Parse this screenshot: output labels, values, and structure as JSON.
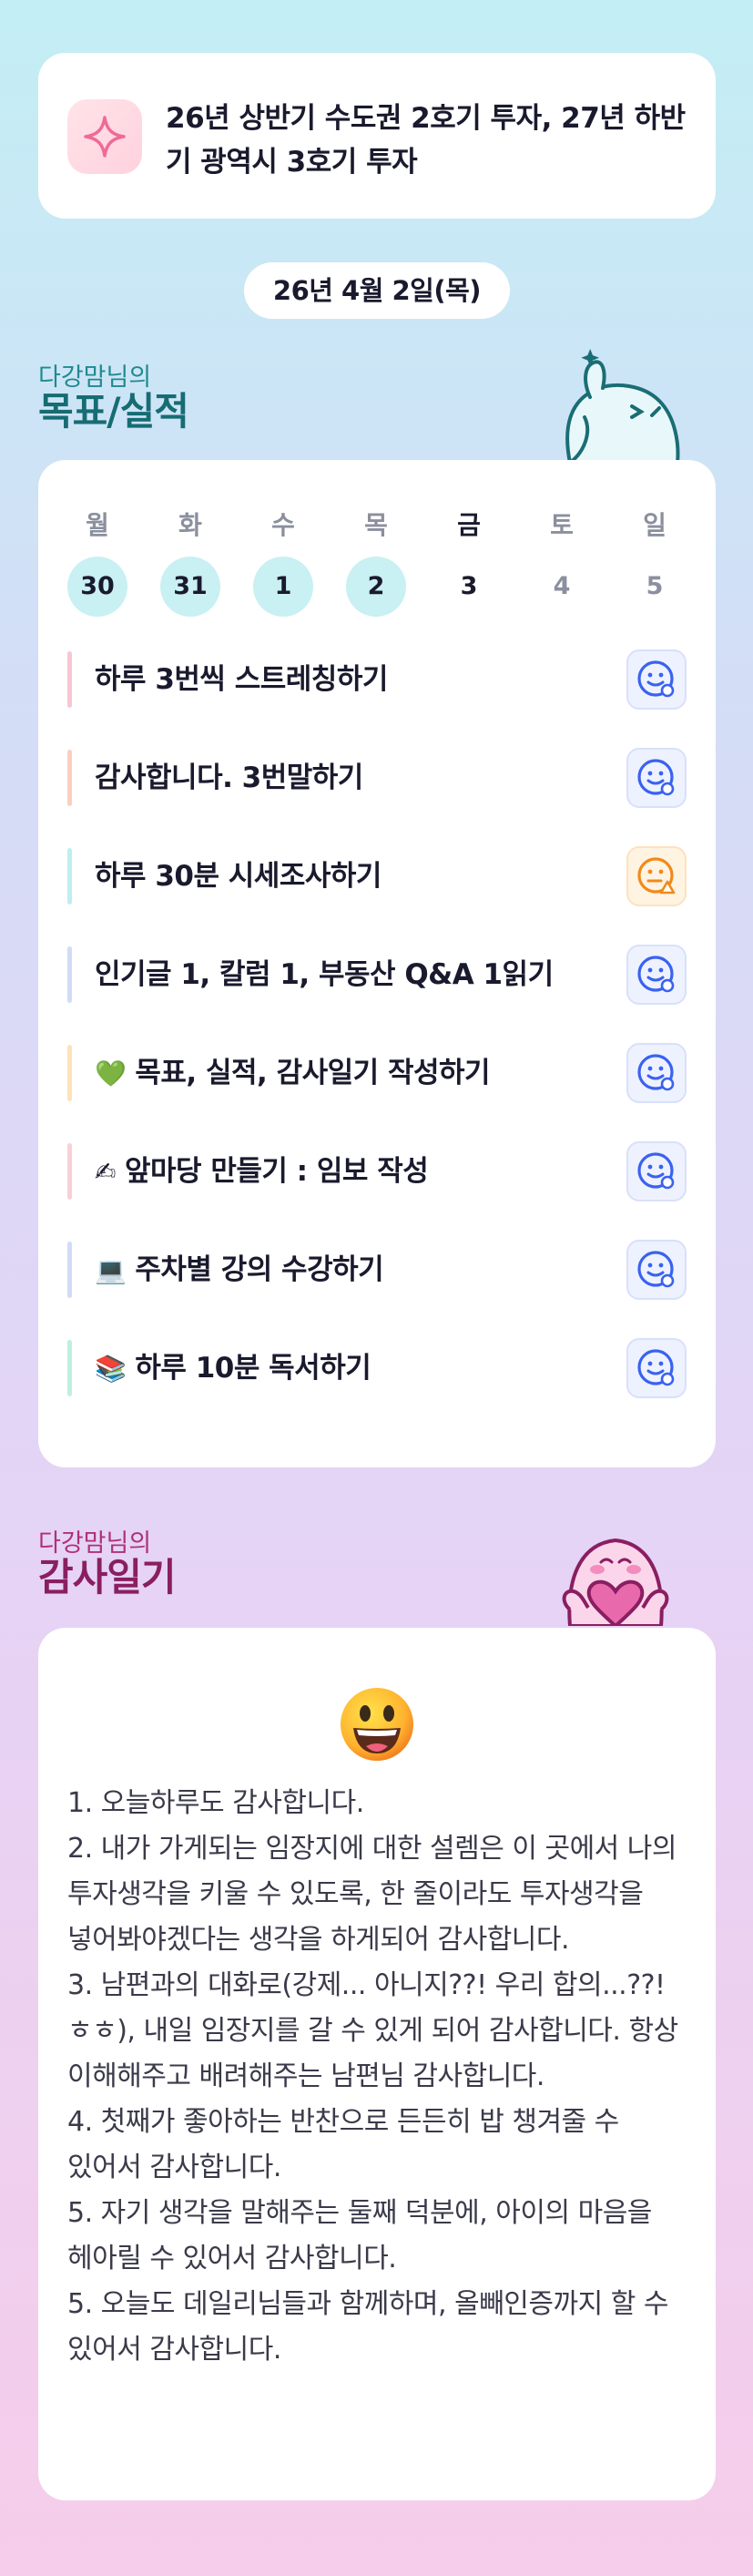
{
  "goal": {
    "icon": "sparkle-icon",
    "text": "26년 상반기 수도권 2호기 투자, 27년 하반기 광역시 3호기 투자"
  },
  "date_label": "26년 4월 2일(목)",
  "goals_section": {
    "subtitle": "다강맘님의",
    "title": "목표/실적"
  },
  "week": {
    "days": [
      {
        "name": "월",
        "num": "30"
      },
      {
        "name": "화",
        "num": "31"
      },
      {
        "name": "수",
        "num": "1"
      },
      {
        "name": "목",
        "num": "2"
      },
      {
        "name": "금",
        "num": "3"
      },
      {
        "name": "토",
        "num": "4"
      },
      {
        "name": "일",
        "num": "5"
      }
    ]
  },
  "tasks": [
    {
      "emoji": "",
      "label": "하루 3번씩 스트레칭하기",
      "status": "smile-icon",
      "bar_color": "#f9c6d4"
    },
    {
      "emoji": "",
      "label": "감사합니다. 3번말하기",
      "status": "smile-icon",
      "bar_color": "#fbcfc0"
    },
    {
      "emoji": "",
      "label": "하루 30분 시세조사하기",
      "status": "warning-face-icon",
      "bar_color": "#bfeef2"
    },
    {
      "emoji": "",
      "label": "인기글 1, 칼럼 1, 부동산 Q&A 1읽기",
      "status": "smile-icon",
      "bar_color": "#d3dcf6"
    },
    {
      "emoji": "💚",
      "label": "목표, 실적, 감사일기 작성하기",
      "status": "smile-icon",
      "bar_color": "#fde3b8"
    },
    {
      "emoji": "✍",
      "label": "앞마당 만들기 : 임보 작성",
      "status": "smile-icon",
      "bar_color": "#f9d0d6"
    },
    {
      "emoji": "💻",
      "label": "주차별 강의 수강하기",
      "status": "smile-icon",
      "bar_color": "#d3dcf6"
    },
    {
      "emoji": "📚",
      "label": "하루 10분 독서하기",
      "status": "smile-icon",
      "bar_color": "#bff0de"
    }
  ],
  "diary_section": {
    "subtitle": "다강맘님의",
    "title": "감사일기"
  },
  "diary": {
    "emoji": "grinning-face-icon",
    "text": "1. 오늘하루도 감사합니다.\n2. 내가 가게되는 임장지에 대한 설렘은 이 곳에서 나의 투자생각을 키울 수 있도록, 한 줄이라도 투자생각을 넣어봐야겠다는 생각을 하게되어 감사합니다.\n3. 남편과의 대화로(강제... 아니지??! 우리 합의...??! ㅎㅎ), 내일 임장지를 갈 수 있게 되어 감사합니다. 항상 이해해주고 배려해주는 남편님 감사합니다.\n4. 첫째가 좋아하는 반찬으로 든든히 밥 챙겨줄 수 있어서 감사합니다.\n5. 자기 생각을 말해주는 둘째 덕분에, 아이의 마음을 헤아릴 수 있어서 감사합니다.\n5. 오늘도 데일리님들과 함께하며, 올빼인증까지 할 수 있어서 감사합니다."
  }
}
